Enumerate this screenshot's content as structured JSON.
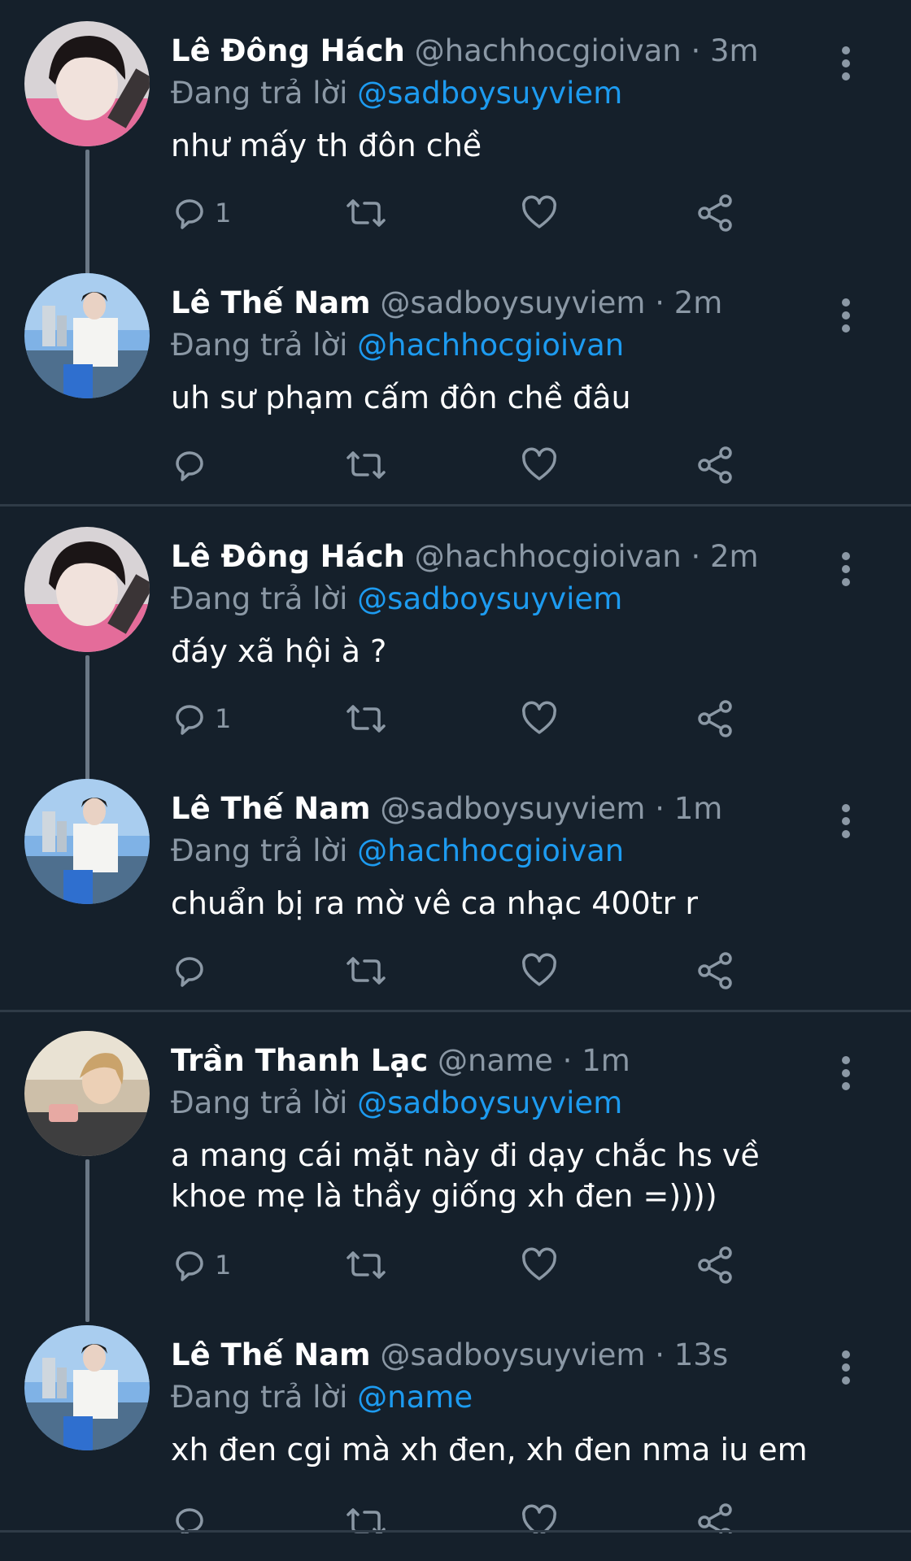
{
  "replying_prefix": "Đang trả lời",
  "colors": {
    "background": "#15202b",
    "text": "#ffffff",
    "muted": "#8b98a5",
    "mention": "#1d9bf0",
    "divider": "#2f3b47"
  },
  "tweets": [
    {
      "name": "Lê Đông Hách",
      "handle": "@hachhocgioivan",
      "time": "3m",
      "replying_to": "@sadboysuyviem",
      "text": "như mấy th đôn chề",
      "reply_count": "1"
    },
    {
      "name": "Lê Thế Nam",
      "handle": "@sadboysuyviem",
      "time": "2m",
      "replying_to": "@hachhocgioivan",
      "text": "uh sư phạm cấm đôn chề đâu",
      "reply_count": ""
    },
    {
      "name": "Lê Đông Hách",
      "handle": "@hachhocgioivan",
      "time": "2m",
      "replying_to": "@sadboysuyviem",
      "text": "đáy xã hội à ?",
      "reply_count": "1"
    },
    {
      "name": "Lê Thế Nam",
      "handle": "@sadboysuyviem",
      "time": "1m",
      "replying_to": "@hachhocgioivan",
      "text": "chuẩn bị ra mờ vê ca nhạc 400tr r",
      "reply_count": ""
    },
    {
      "name": "Trần Thanh Lạc",
      "handle": "@name",
      "time": "1m",
      "replying_to": "@sadboysuyviem",
      "text": "a mang cái mặt này đi dạy chắc hs về khoe mẹ là thầy giống xh đen =))))",
      "reply_count": "1"
    },
    {
      "name": "Lê Thế Nam",
      "handle": "@sadboysuyviem",
      "time": "13s",
      "replying_to": "@name",
      "text": "xh đen cgi mà xh đen, xh đen nma iu em",
      "reply_count": ""
    }
  ],
  "icons": {
    "reply": "reply-icon",
    "retweet": "retweet-icon",
    "like": "heart-icon",
    "share": "share-icon",
    "more": "more-options-icon"
  }
}
